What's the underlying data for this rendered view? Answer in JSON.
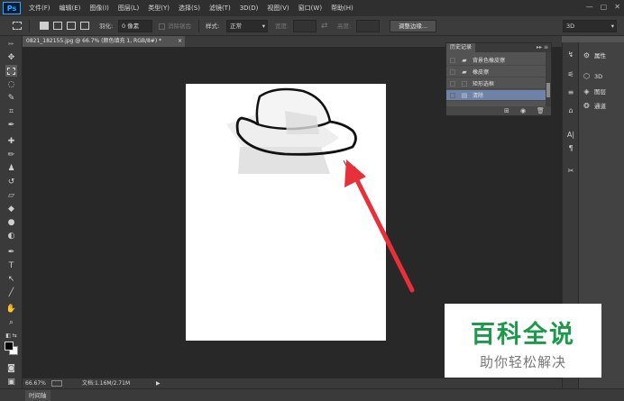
{
  "menubar": {
    "logo": "Ps",
    "items": [
      "文件(F)",
      "编辑(E)",
      "图像(I)",
      "图层(L)",
      "类型(Y)",
      "选择(S)",
      "滤镜(T)",
      "3D(D)",
      "视图(V)",
      "窗口(W)",
      "帮助(H)"
    ],
    "window_controls": [
      "—",
      "▢",
      "✕"
    ]
  },
  "options": {
    "feather_label": "羽化:",
    "feather_value": "0 像素",
    "antialias_label": "消除锯齿",
    "style_label": "样式:",
    "style_value": "正常",
    "width_label": "宽度:",
    "height_label": "高度:",
    "refine_edge_button": "调整边缘...",
    "workspace_value": "3D"
  },
  "document": {
    "tab_title": "0821_182155.jpg @ 66.7% (颜色填充 1, RGB/8#) *",
    "close": "×"
  },
  "status": {
    "zoom": "66.67%",
    "doc_info": "文档:1.16M/2.71M",
    "arrow": "▶"
  },
  "timeline": {
    "label": "时间轴"
  },
  "history": {
    "tab_label": "历史记录",
    "menu": "▸▸ ≡",
    "items": [
      {
        "icon": "eraser-icon",
        "label": "背景色橡皮擦"
      },
      {
        "icon": "eraser-icon",
        "label": "橡皮擦"
      },
      {
        "icon": "marquee-icon",
        "label": "矩形选框"
      },
      {
        "icon": "deselect-icon",
        "label": "清除"
      }
    ],
    "active_index": 3
  },
  "dock": {
    "entries": [
      {
        "icon": "properties-icon",
        "label": "属性"
      },
      {
        "icon": "3d-icon",
        "label": "3D"
      },
      {
        "icon": "layers-icon",
        "label": "图层"
      },
      {
        "icon": "channels-icon",
        "label": "通道"
      }
    ]
  },
  "watermark": {
    "title": "百科全说",
    "subtitle": "助你轻松解决"
  },
  "colors": {
    "accent_arrow": "#e8303a",
    "watermark_green": "#1b9a4a",
    "history_active": "#6d84a8"
  }
}
